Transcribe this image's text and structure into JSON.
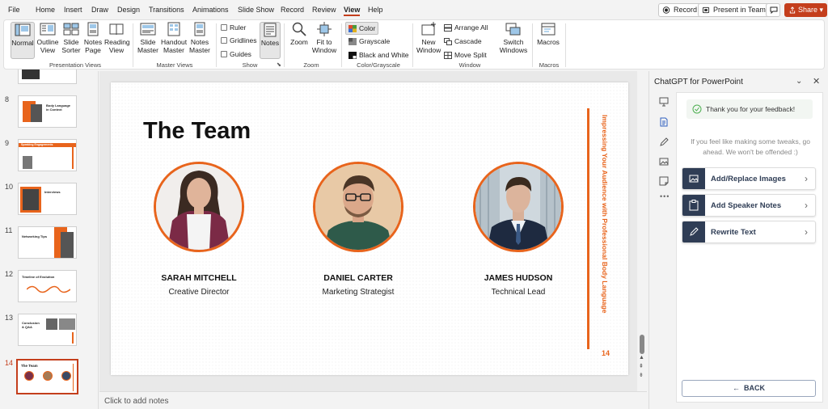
{
  "menu": {
    "items": [
      "File",
      "Home",
      "Insert",
      "Draw",
      "Design",
      "Transitions",
      "Animations",
      "Slide Show",
      "Record",
      "Review",
      "View",
      "Help"
    ],
    "active": "View",
    "record_label": "Record",
    "present_label": "Present in Teams",
    "share_label": "Share"
  },
  "ribbon": {
    "presentation_views": {
      "normal": "Normal",
      "outline": "Outline\nView",
      "sorter": "Slide\nSorter",
      "notes_page": "Notes\nPage",
      "reading": "Reading\nView",
      "group": "Presentation Views"
    },
    "master_views": {
      "slide": "Slide\nMaster",
      "handout": "Handout\nMaster",
      "notes": "Notes\nMaster",
      "group": "Master Views"
    },
    "show": {
      "ruler": "Ruler",
      "gridlines": "Gridlines",
      "guides": "Guides",
      "notes": "Notes",
      "group": "Show"
    },
    "zoom": {
      "zoom": "Zoom",
      "fit": "Fit to\nWindow",
      "group": "Zoom"
    },
    "color": {
      "color": "Color",
      "grayscale": "Grayscale",
      "bw": "Black and White",
      "group": "Color/Grayscale"
    },
    "window": {
      "new": "New\nWindow",
      "arrange": "Arrange All",
      "cascade": "Cascade",
      "move_split": "Move Split",
      "switch": "Switch\nWindows",
      "group": "Window"
    },
    "macros": {
      "macros": "Macros",
      "group": "Macros"
    }
  },
  "thumbnails": {
    "numbers": [
      "8",
      "9",
      "10",
      "11",
      "12",
      "13",
      "14"
    ],
    "titles": [
      "Body Language in Context",
      "Speaking Engagements",
      "Interviews",
      "Networking Tips",
      "Timeline of Evolution",
      "Conclusion & Q&A",
      "The Team"
    ],
    "selected": "14"
  },
  "slide": {
    "title": "The Team",
    "side_text": "Impressing Your Audience with Professional Body Language",
    "number": "14",
    "accent": "#e8641c",
    "members": [
      {
        "name": "SARAH MITCHELL",
        "role": "Creative Director"
      },
      {
        "name": "DANIEL CARTER",
        "role": "Marketing Strategist"
      },
      {
        "name": "JAMES HUDSON",
        "role": "Technical Lead"
      }
    ]
  },
  "notes_placeholder": "Click to add notes",
  "pane": {
    "title": "ChatGPT for PowerPoint",
    "feedback": "Thank you for your feedback!",
    "hint": "If you feel like making some tweaks, go ahead. We won't be offended :)",
    "actions": [
      "Add/Replace Images",
      "Add Speaker Notes",
      "Rewrite Text"
    ],
    "back": "BACK"
  }
}
